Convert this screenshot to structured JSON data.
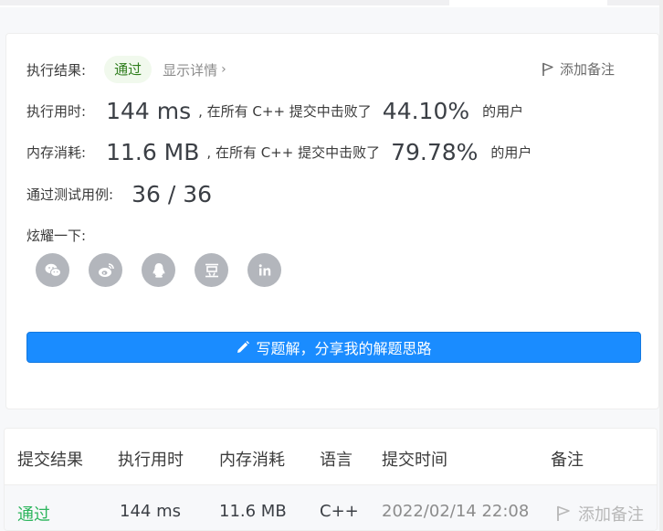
{
  "result": {
    "label": "执行结果:",
    "status": "通过",
    "details": "显示详情",
    "add_note": "添加备注"
  },
  "runtime": {
    "label": "执行用时:",
    "value": "144 ms",
    "mid_text": ", 在所有 C++ 提交中击败了",
    "percent": "44.10%",
    "suffix": "的用户"
  },
  "memory": {
    "label": "内存消耗:",
    "value": "11.6 MB",
    "mid_text": ", 在所有 C++ 提交中击败了",
    "percent": "79.78%",
    "suffix": "的用户"
  },
  "testcases": {
    "label": "通过测试用例:",
    "value": "36 / 36"
  },
  "share": {
    "label": "炫耀一下:",
    "icons": [
      "wechat-icon",
      "weibo-icon",
      "qq-icon",
      "douban-icon",
      "linkedin-icon"
    ]
  },
  "write_solution": "写题解，分享我的解题思路",
  "table": {
    "headers": [
      "提交结果",
      "执行用时",
      "内存消耗",
      "语言",
      "提交时间",
      "备注"
    ],
    "row": {
      "result": "通过",
      "runtime": "144 ms",
      "memory": "11.6 MB",
      "language": "C++",
      "time": "2022/02/14 22:08",
      "note": "添加备注"
    }
  },
  "colors": {
    "accent": "#1a8cff",
    "pass": "#2db55d"
  }
}
